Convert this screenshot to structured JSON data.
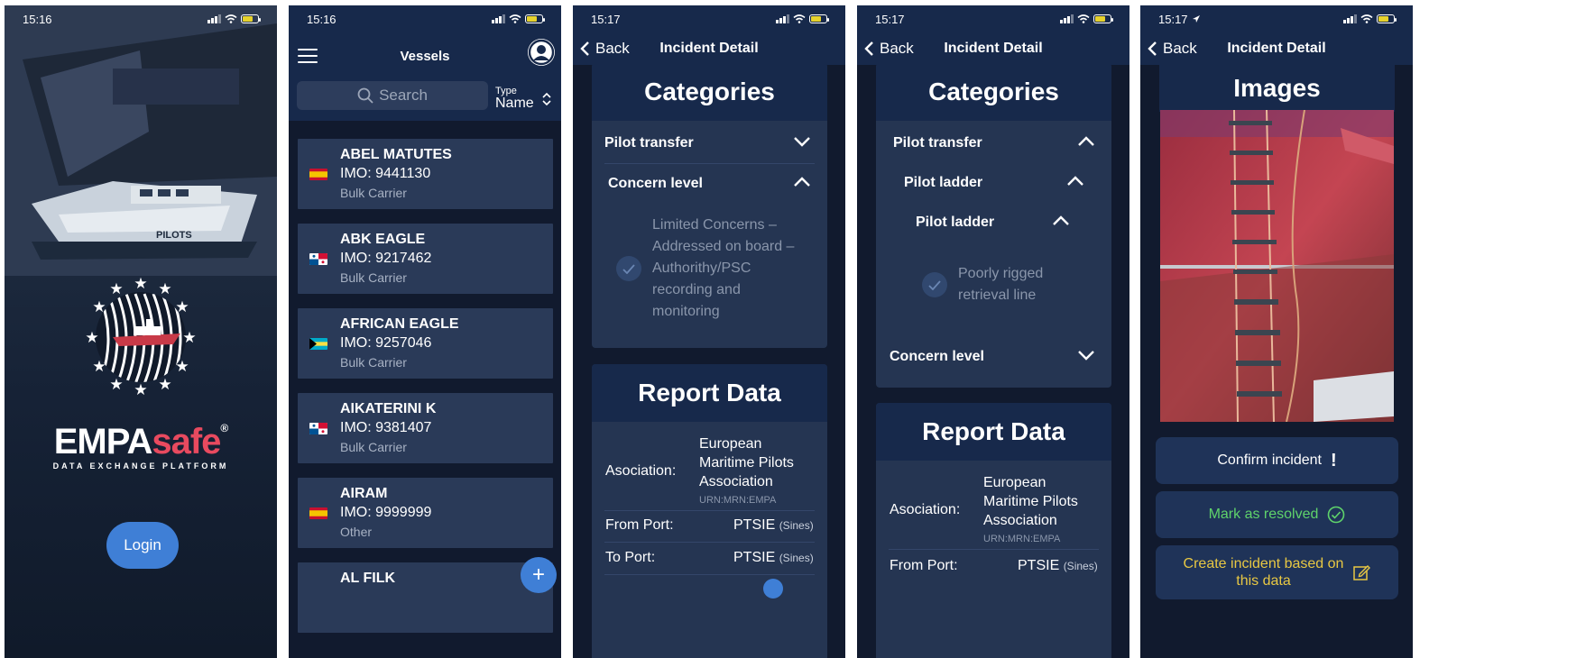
{
  "colors": {
    "navy": "#17294b",
    "card": "#2a3a58",
    "accent": "#3f7fd6",
    "brand_red": "#e84a5f",
    "green": "#5fd36b",
    "yellow": "#e8c843"
  },
  "screen1": {
    "time": "15:16",
    "brand_empa": "EMPA",
    "brand_safe": "safe",
    "registered": "®",
    "subtitle": "DATA EXCHANGE PLATFORM",
    "boat_text": "PILOTS",
    "login_label": "Login"
  },
  "screen2": {
    "time": "15:16",
    "title": "Vessels",
    "search_placeholder": "Search",
    "sort_small": "Type",
    "sort_value": "Name",
    "fab_label": "+",
    "vessels": [
      {
        "name": "ABEL MATUTES",
        "imo": "IMO: 9441130",
        "type": "Bulk Carrier",
        "flag": "spain"
      },
      {
        "name": "ABK EAGLE",
        "imo": "IMO: 9217462",
        "type": "Bulk Carrier",
        "flag": "panama"
      },
      {
        "name": "AFRICAN EAGLE",
        "imo": "IMO: 9257046",
        "type": "Bulk Carrier",
        "flag": "bahamas"
      },
      {
        "name": "AIKATERINI K",
        "imo": "IMO: 9381407",
        "type": "Bulk Carrier",
        "flag": "panama"
      },
      {
        "name": "AIRAM",
        "imo": "IMO: 9999999",
        "type": "Other",
        "flag": "spain"
      },
      {
        "name": "AL FILK",
        "imo": "",
        "type": "",
        "flag": ""
      }
    ]
  },
  "screen3": {
    "time": "15:17",
    "back_label": "Back",
    "title": "Incident Detail",
    "categories_title": "Categories",
    "pilot_transfer": "Pilot transfer",
    "concern_level": "Concern level",
    "concern_lines": [
      "Limited Concerns –",
      "Addressed on board –",
      "Authorithy/PSC",
      "recording and",
      "monitoring"
    ],
    "report_title": "Report Data",
    "association_label": "Asociation:",
    "association_lines": [
      "European",
      "Maritime Pilots",
      "Association"
    ],
    "association_urn": "URN:MRN:EMPA",
    "from_port_label": "From Port:",
    "from_port_value": "PTSIE",
    "from_port_small": "(Sines)",
    "to_port_label": "To Port:",
    "to_port_value": "PTSIE",
    "to_port_small": "(Sines)"
  },
  "screen4": {
    "time": "15:17",
    "back_label": "Back",
    "title": "Incident Detail",
    "categories_title": "Categories",
    "pilot_transfer": "Pilot transfer",
    "pilot_ladder_1": "Pilot ladder",
    "pilot_ladder_2": "Pilot ladder",
    "issue_lines": [
      "Poorly rigged",
      "retrieval line"
    ],
    "concern_level": "Concern level",
    "report_title": "Report Data",
    "association_label": "Asociation:",
    "association_lines": [
      "European",
      "Maritime Pilots",
      "Association"
    ],
    "association_urn": "URN:MRN:EMPA",
    "from_port_label": "From Port:",
    "from_port_value": "PTSIE",
    "from_port_small": "(Sines)"
  },
  "screen5": {
    "time": "15:17",
    "back_label": "Back",
    "title": "Incident Detail",
    "images_title": "Images",
    "confirm_label": "Confirm incident",
    "confirm_icon": "!",
    "resolve_label": "Mark as resolved",
    "create_lines": [
      "Create incident based on",
      "this data"
    ]
  }
}
